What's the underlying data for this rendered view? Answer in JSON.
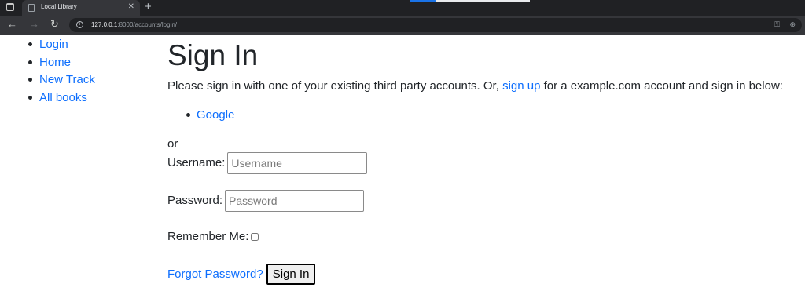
{
  "browser": {
    "tab_title": "Local Library",
    "tab_close": "✕",
    "new_tab": "+",
    "url_host": "127.0.0.1",
    "url_rest": ":8000/accounts/login/",
    "back": "←",
    "forward": "→",
    "reload": "↻",
    "info": "i",
    "key_icon": "⚿",
    "zoom_icon": "⊕"
  },
  "sidebar": {
    "items": [
      {
        "label": "Login"
      },
      {
        "label": "Home"
      },
      {
        "label": "New Track"
      },
      {
        "label": "All books"
      }
    ]
  },
  "main": {
    "title": "Sign In",
    "intro_before": "Please sign in with one of your existing third party accounts. Or, ",
    "signup_link": "sign up",
    "intro_after": " for a example.com account and sign in below:",
    "providers": [
      {
        "label": "Google"
      }
    ],
    "or": "or"
  },
  "form": {
    "username_label": "Username:",
    "username_placeholder": "Username",
    "password_label": "Password:",
    "password_placeholder": "Password",
    "remember_label": "Remember Me:",
    "remember_checked": false,
    "forgot_link": "Forgot Password?",
    "submit_label": "Sign In"
  },
  "colors": {
    "link": "#0d6efd",
    "text": "#212529",
    "chrome_dark": "#202124",
    "chrome_toolbar": "#35363a"
  }
}
